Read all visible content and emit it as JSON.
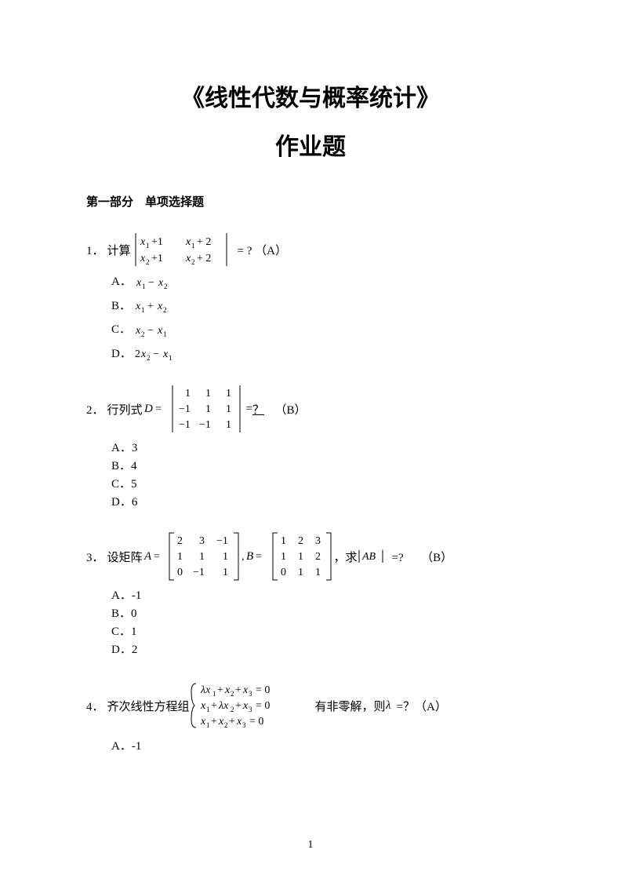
{
  "page": {
    "title": "《线性代数与概率统计》",
    "subtitle": "作业题",
    "section_heading": "第一部分　单项选择题",
    "page_number": "1"
  },
  "q1": {
    "num": "1．",
    "prefix": "计算",
    "suffix": "= ?  （A）",
    "options": {
      "A": "A．",
      "B": "B．",
      "C": "C．",
      "D": "D．"
    }
  },
  "q2": {
    "num": "2．",
    "prefix": "行列式",
    "mid": " = ",
    "underline": "？",
    "suffix": "　（B）",
    "options": {
      "A": "A．3",
      "B": "B．4",
      "C": "C．5",
      "D": "D．6"
    }
  },
  "q3": {
    "num": "3．",
    "prefix": "设矩阵",
    "mid": "，求",
    "suffix": "=?　　（B）",
    "options": {
      "A": "A．-1",
      "B": "B．0",
      "C": "C．1",
      "D": "D．2"
    }
  },
  "q4": {
    "num": "4．",
    "prefix": "齐次线性方程组",
    "mid": "有非零解，则",
    "suffix": "=？（A）",
    "options": {
      "A": "A．-1"
    }
  }
}
